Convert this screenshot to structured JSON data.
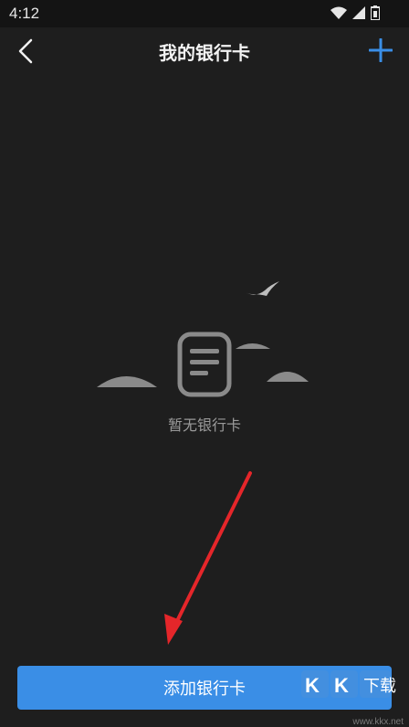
{
  "status_bar": {
    "time": "4:12"
  },
  "header": {
    "title": "我的银行卡"
  },
  "empty_state": {
    "message": "暂无银行卡"
  },
  "footer": {
    "add_button_label": "添加银行卡"
  },
  "watermark": {
    "text": "www.kkx.net",
    "logo_text": "KK下载"
  },
  "colors": {
    "accent": "#3a8ee6",
    "background": "#1e1e1e",
    "arrow": "#e5262a"
  },
  "icons": {
    "back": "chevron-left-icon",
    "add": "plus-icon",
    "wifi": "wifi-icon",
    "signal": "signal-icon",
    "battery": "battery-icon"
  }
}
